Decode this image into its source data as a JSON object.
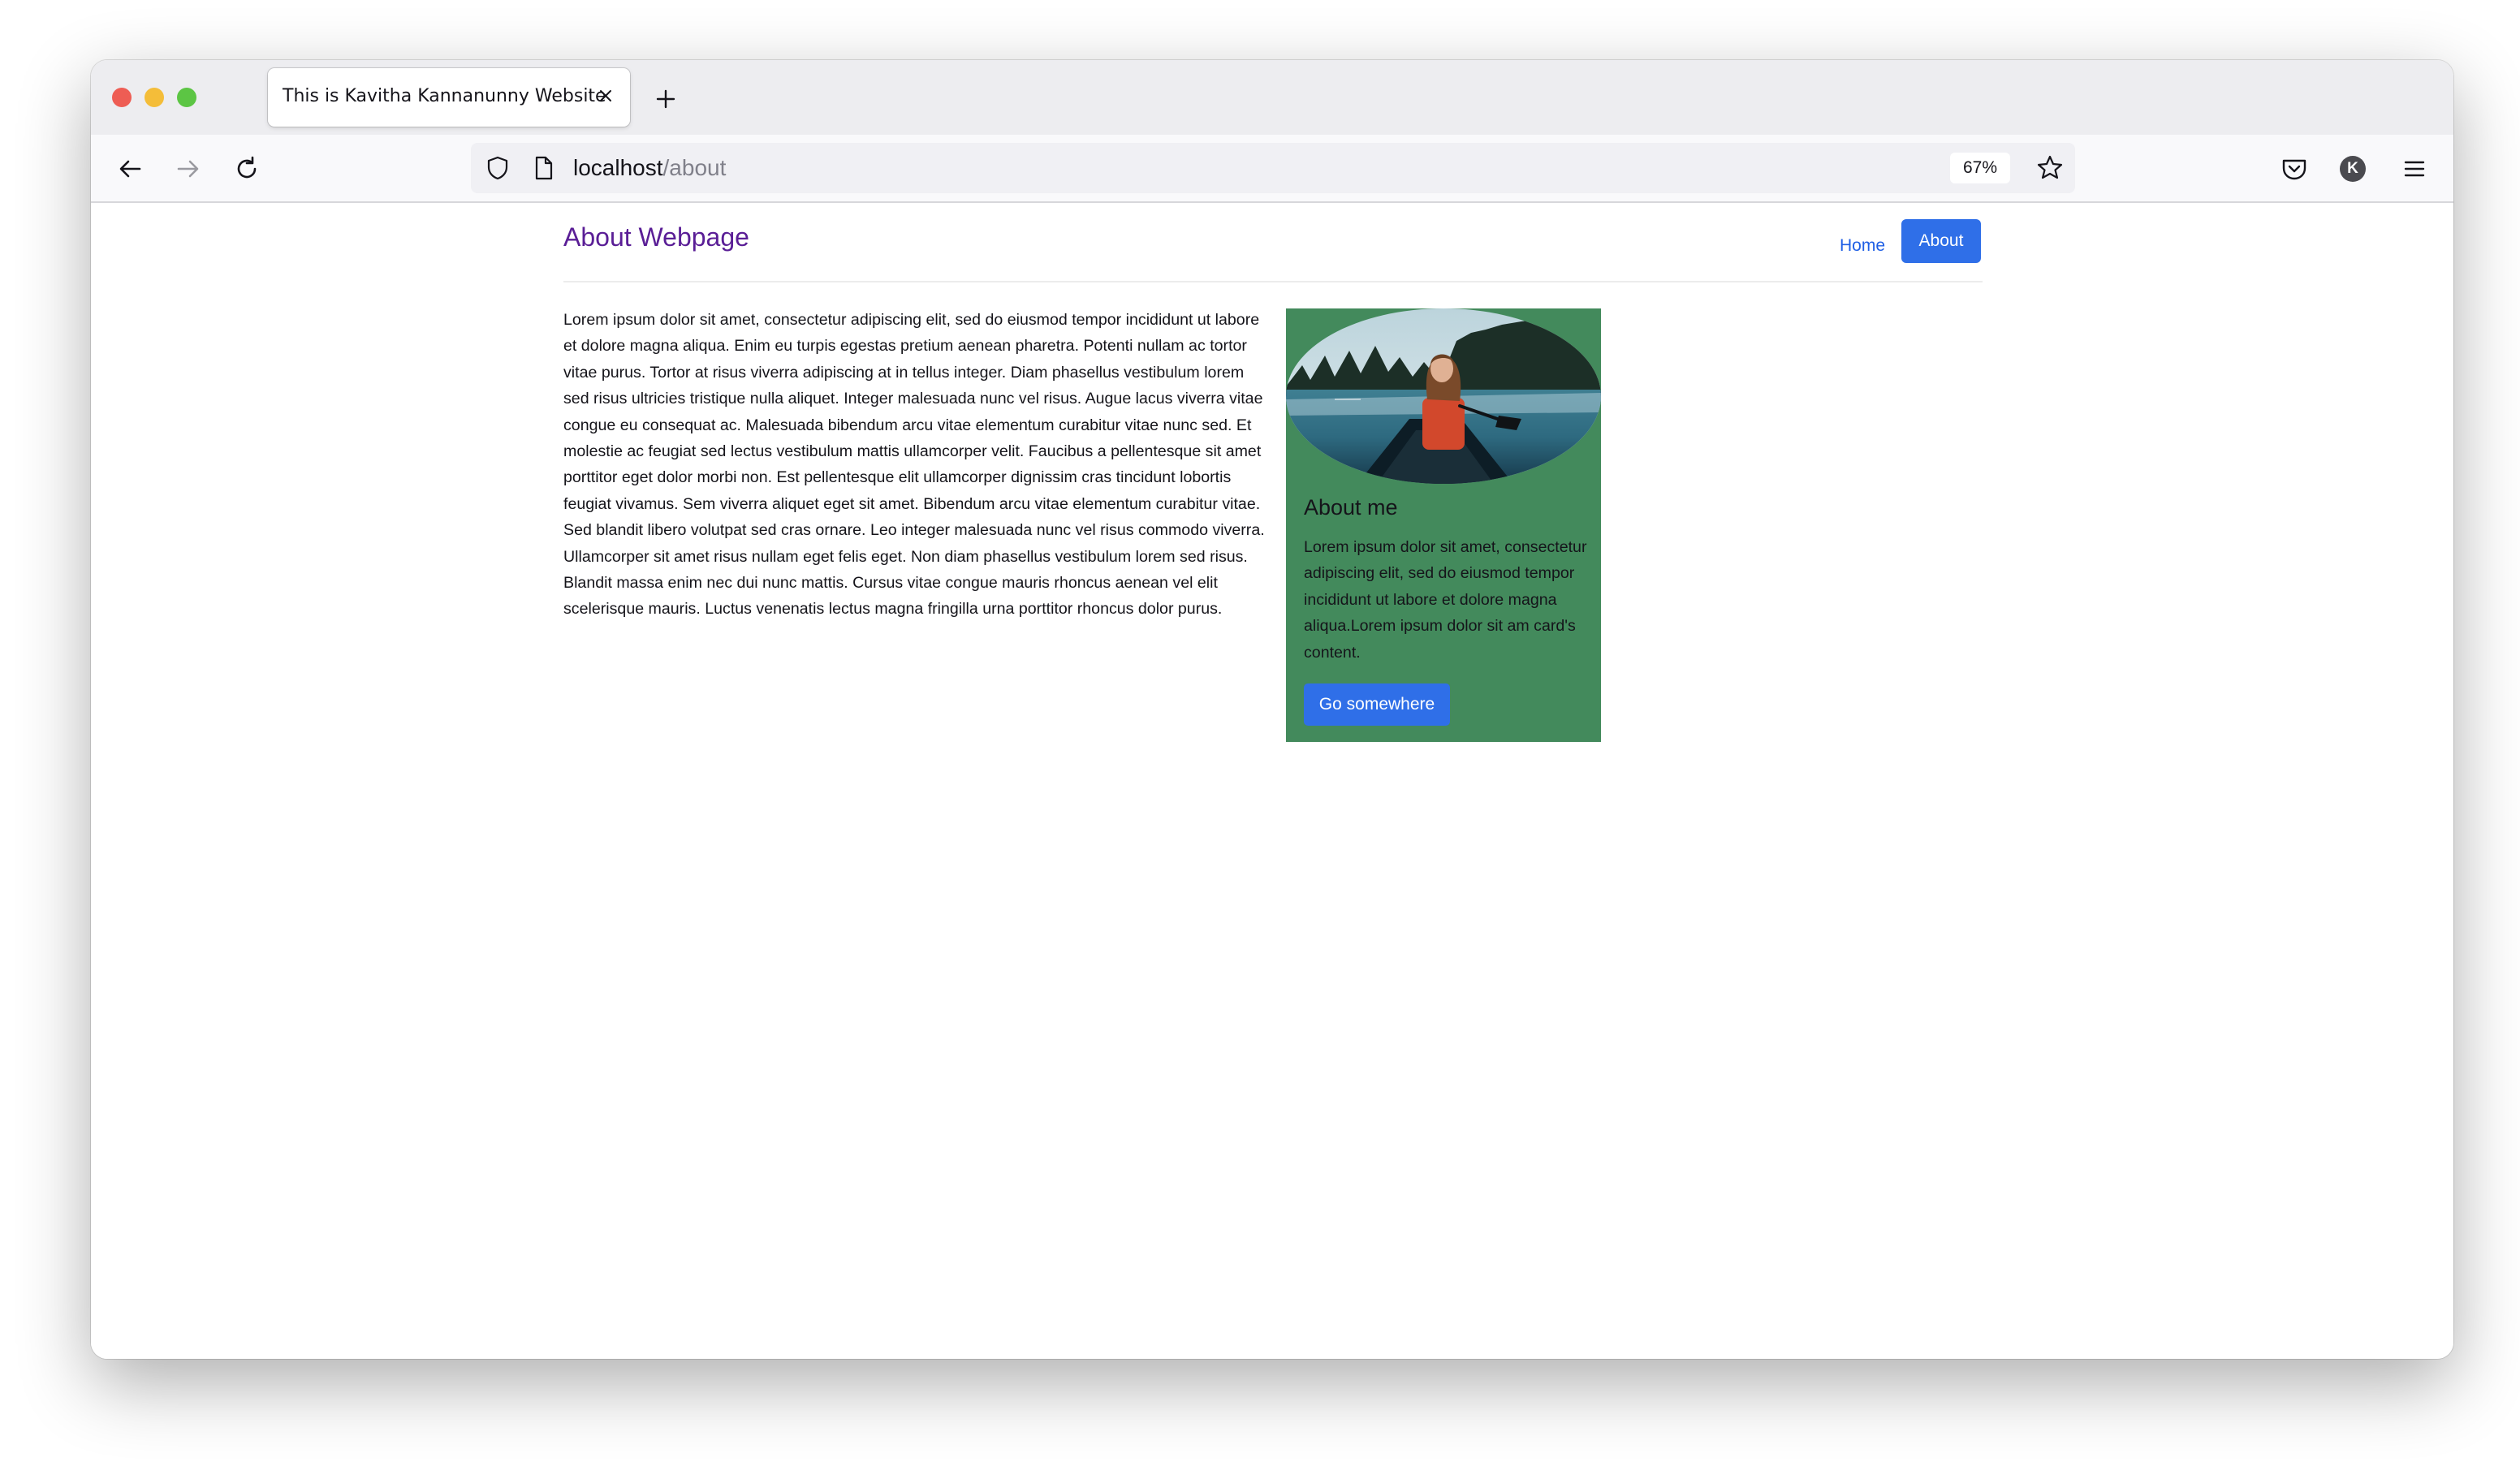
{
  "browser": {
    "tab_title": "This is Kavitha Kannanunny Website",
    "url_host": "localhost",
    "url_path": "/about",
    "zoom": "67%",
    "profile_initial": "K"
  },
  "site": {
    "brand": "About Webpage",
    "nav": {
      "home": "Home",
      "about": "About"
    }
  },
  "article": {
    "body": "Lorem ipsum dolor sit amet, consectetur adipiscing elit, sed do eiusmod tempor incididunt ut labore et dolore magna aliqua. Enim eu turpis egestas pretium aenean pharetra. Potenti nullam ac tortor vitae purus. Tortor at risus viverra adipiscing at in tellus integer. Diam phasellus vestibulum lorem sed risus ultricies tristique nulla aliquet. Integer malesuada nunc vel risus. Augue lacus viverra vitae congue eu consequat ac. Malesuada bibendum arcu vitae elementum curabitur vitae nunc sed. Et molestie ac feugiat sed lectus vestibulum mattis ullamcorper velit. Faucibus a pellentesque sit amet porttitor eget dolor morbi non. Est pellentesque elit ullamcorper dignissim cras tincidunt lobortis feugiat vivamus. Sem viverra aliquet eget sit amet. Bibendum arcu vitae elementum curabitur vitae. Sed blandit libero volutpat sed cras ornare. Leo integer malesuada nunc vel risus commodo viverra. Ullamcorper sit amet risus nullam eget felis eget. Non diam phasellus vestibulum lorem sed risus. Blandit massa enim nec dui nunc mattis. Cursus vitae congue mauris rhoncus aenean vel elit scelerisque mauris. Luctus venenatis lectus magna fringilla urna porttitor rhoncus dolor purus."
  },
  "card": {
    "title": "About me",
    "text": "Lorem ipsum dolor sit amet, consectetur adipiscing elit, sed do eiusmod tempor incididunt ut labore et dolore magna aliqua.Lorem ipsum dolor sit am card's content.",
    "button": "Go somewhere",
    "background": "#438a5c"
  },
  "colors": {
    "brand": "#5a1e96",
    "primary": "#2f6fe8"
  },
  "icons": {
    "back": "arrow-left-icon",
    "forward": "arrow-right-icon",
    "reload": "reload-icon",
    "shield": "shield-icon",
    "page": "page-icon",
    "star": "star-icon",
    "pocket": "pocket-icon",
    "menu": "hamburger-menu-icon",
    "close": "close-icon",
    "new_tab": "plus-icon"
  }
}
